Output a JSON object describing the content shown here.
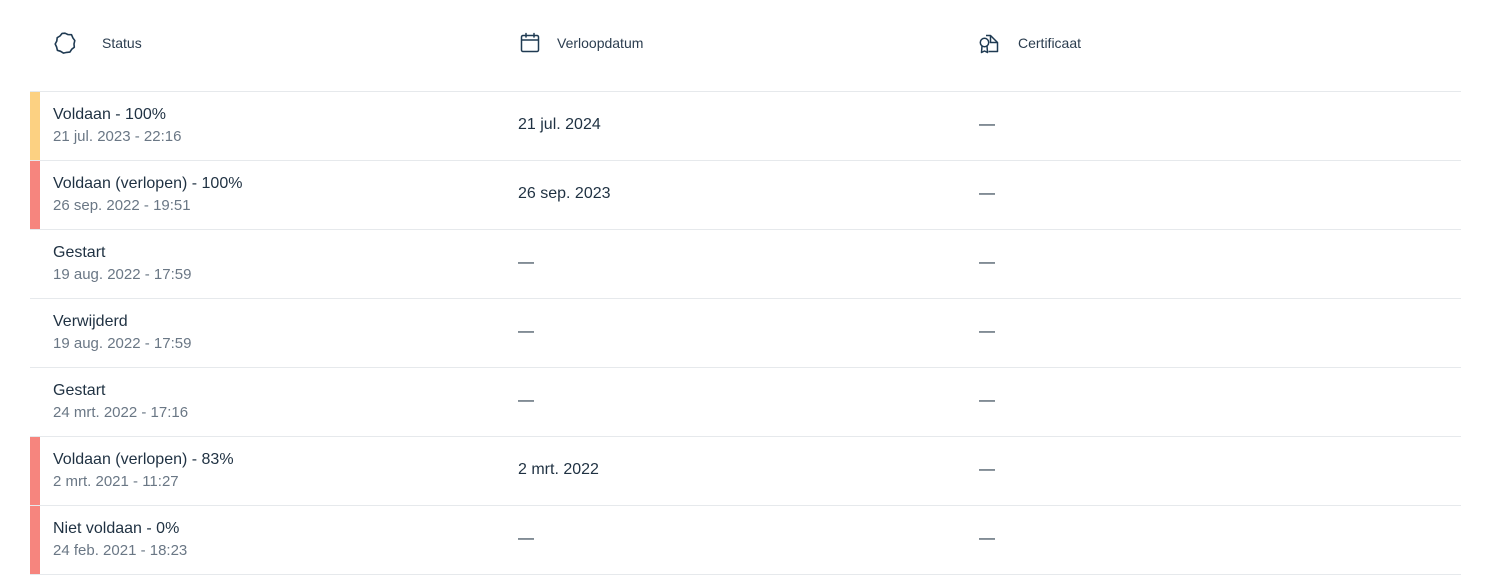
{
  "colors": {
    "bar_yellow": "#fcd182",
    "bar_red": "#f6857e",
    "bar_none": "transparent",
    "icon_stroke": "#1f3a52"
  },
  "header": {
    "status": {
      "label": "Status",
      "icon": "badge-icon"
    },
    "expiry": {
      "label": "Verloopdatum",
      "icon": "calendar-icon"
    },
    "certificate": {
      "label": "Certificaat",
      "icon": "certificate-icon"
    }
  },
  "rows": [
    {
      "indicator": "yellow",
      "status": "Voldaan - 100%",
      "date": "21 jul. 2023 - 22:16",
      "expiry": "21 jul. 2024",
      "certificate": "—"
    },
    {
      "indicator": "red",
      "status": "Voldaan (verlopen) - 100%",
      "date": "26 sep. 2022 - 19:51",
      "expiry": "26 sep. 2023",
      "certificate": "—"
    },
    {
      "indicator": "none",
      "status": "Gestart",
      "date": "19 aug. 2022 - 17:59",
      "expiry": "—",
      "certificate": "—"
    },
    {
      "indicator": "none",
      "status": "Verwijderd",
      "date": "19 aug. 2022 - 17:59",
      "expiry": "—",
      "certificate": "—"
    },
    {
      "indicator": "none",
      "status": "Gestart",
      "date": "24 mrt. 2022 - 17:16",
      "expiry": "—",
      "certificate": "—"
    },
    {
      "indicator": "red",
      "status": "Voldaan (verlopen) - 83%",
      "date": "2 mrt. 2021 - 11:27",
      "expiry": "2 mrt. 2022",
      "certificate": "—"
    },
    {
      "indicator": "red",
      "status": "Niet voldaan - 0%",
      "date": "24 feb. 2021 - 18:23",
      "expiry": "—",
      "certificate": "—"
    }
  ]
}
